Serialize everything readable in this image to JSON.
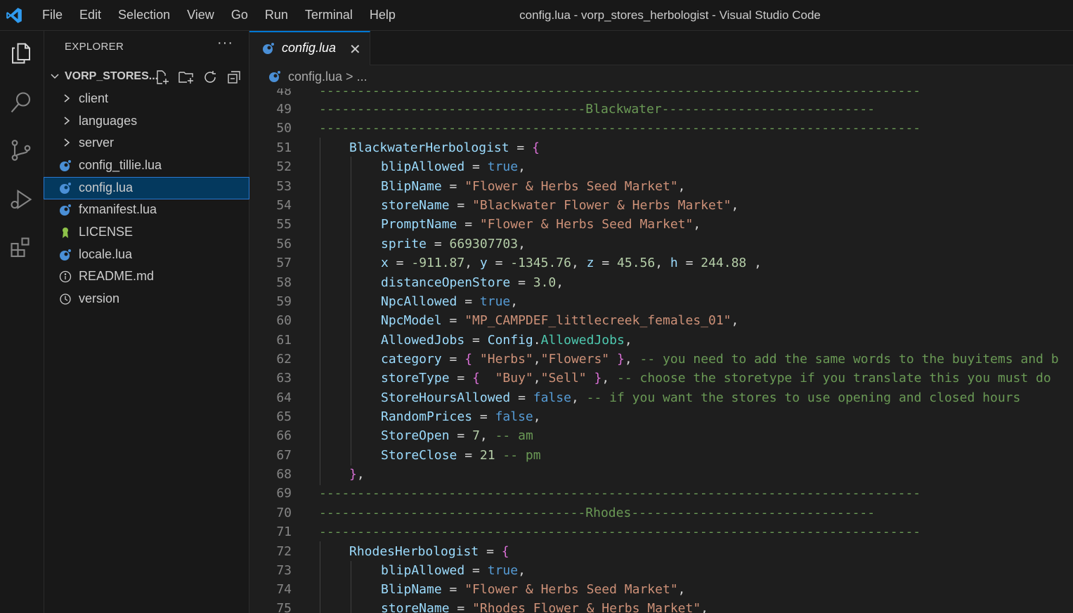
{
  "titlebar": {
    "menu": [
      "File",
      "Edit",
      "Selection",
      "View",
      "Go",
      "Run",
      "Terminal",
      "Help"
    ],
    "window_title": "config.lua - vorp_stores_herbologist - Visual Studio Code"
  },
  "sidebar": {
    "title": "EXPLORER",
    "more": "···",
    "folder_name": "VORP_STORES...",
    "items": [
      {
        "label": "client",
        "type": "folder"
      },
      {
        "label": "languages",
        "type": "folder"
      },
      {
        "label": "server",
        "type": "folder"
      },
      {
        "label": "config_tillie.lua",
        "type": "lua"
      },
      {
        "label": "config.lua",
        "type": "lua",
        "selected": true
      },
      {
        "label": "fxmanifest.lua",
        "type": "lua"
      },
      {
        "label": "LICENSE",
        "type": "license"
      },
      {
        "label": "locale.lua",
        "type": "lua"
      },
      {
        "label": "README.md",
        "type": "info"
      },
      {
        "label": "version",
        "type": "clock"
      }
    ]
  },
  "editor": {
    "tab_label": "config.lua",
    "tab_close": "✕",
    "breadcrumb": "config.lua > ...",
    "lines": [
      {
        "n": "48",
        "t": ""
      },
      {
        "n": "49",
        "t": ""
      },
      {
        "n": "50",
        "t": ""
      },
      {
        "n": "51",
        "t": ""
      },
      {
        "n": "52",
        "t": ""
      },
      {
        "n": "53",
        "t": ""
      },
      {
        "n": "54",
        "t": ""
      },
      {
        "n": "55",
        "t": ""
      },
      {
        "n": "56",
        "t": ""
      },
      {
        "n": "57",
        "t": ""
      },
      {
        "n": "58",
        "t": ""
      },
      {
        "n": "59",
        "t": ""
      },
      {
        "n": "60",
        "t": ""
      },
      {
        "n": "61",
        "t": ""
      },
      {
        "n": "62",
        "t": ""
      },
      {
        "n": "63",
        "t": ""
      },
      {
        "n": "64",
        "t": ""
      },
      {
        "n": "65",
        "t": ""
      },
      {
        "n": "66",
        "t": ""
      },
      {
        "n": "67",
        "t": ""
      },
      {
        "n": "68",
        "t": ""
      },
      {
        "n": "69",
        "t": ""
      },
      {
        "n": "70",
        "t": ""
      },
      {
        "n": "71",
        "t": ""
      },
      {
        "n": "72",
        "t": ""
      },
      {
        "n": "73",
        "t": ""
      },
      {
        "n": "74",
        "t": ""
      },
      {
        "n": "75",
        "t": ""
      }
    ],
    "code": {
      "l48": "-------------------------------------------------------------------------------",
      "l49": "-----------------------------------Blackwater----------------------------",
      "l50": "-------------------------------------------------------------------------------",
      "l51a": "BlackwaterHerbologist",
      "l51b": " = ",
      "l51c": "{",
      "l52a": "blipAllowed",
      "l52b": " = ",
      "l52c": "true",
      "l52d": ",",
      "l53a": "BlipName",
      "l53b": " = ",
      "l53c": "\"Flower & Herbs Seed Market\"",
      "l53d": ",",
      "l54a": "storeName",
      "l54b": " = ",
      "l54c": "\"Blackwater Flower & Herbs Market\"",
      "l54d": ",",
      "l55a": "PromptName",
      "l55b": " = ",
      "l55c": "\"Flower & Herbs Seed Market\"",
      "l55d": ",",
      "l56a": "sprite",
      "l56b": " = ",
      "l56c": "669307703",
      "l56d": ",",
      "l57a": "x",
      "l57b": " = ",
      "l57c": "-911.87",
      "l57d": ", ",
      "l57e": "y",
      "l57f": " = ",
      "l57g": "-1345.76",
      "l57h": ", ",
      "l57i": "z",
      "l57j": " = ",
      "l57k": "45.56",
      "l57l": ", ",
      "l57m": "h",
      "l57n": " = ",
      "l57o": "244.88",
      "l57p": " ,",
      "l58a": "distanceOpenStore",
      "l58b": " = ",
      "l58c": "3.0",
      "l58d": ",",
      "l59a": "NpcAllowed",
      "l59b": " = ",
      "l59c": "true",
      "l59d": ",",
      "l60a": "NpcModel",
      "l60b": " = ",
      "l60c": "\"MP_CAMPDEF_littlecreek_females_01\"",
      "l60d": ",",
      "l61a": "AllowedJobs",
      "l61b": " = ",
      "l61c": "Config",
      "l61d": ".",
      "l61e": "AllowedJobs",
      "l61f": ",",
      "l62a": "category",
      "l62b": " = ",
      "l62c": "{ ",
      "l62d": "\"Herbs\"",
      "l62e": ",",
      "l62f": "\"Flowers\"",
      "l62g": " }",
      "l62h": ", ",
      "l62i": "-- you need to add the same words to the buyitems and b",
      "l63a": "storeType",
      "l63b": " = ",
      "l63c": "{  ",
      "l63d": "\"Buy\"",
      "l63e": ",",
      "l63f": "\"Sell\"",
      "l63g": " }",
      "l63h": ", ",
      "l63i": "-- choose the storetype if you translate this you must do",
      "l64a": "StoreHoursAllowed",
      "l64b": " = ",
      "l64c": "false",
      "l64d": ", ",
      "l64e": "-- if you want the stores to use opening and closed hours",
      "l65a": "RandomPrices",
      "l65b": " = ",
      "l65c": "false",
      "l65d": ",",
      "l66a": "StoreOpen",
      "l66b": " = ",
      "l66c": "7",
      "l66d": ", ",
      "l66e": "-- am",
      "l67a": "StoreClose",
      "l67b": " = ",
      "l67c": "21",
      "l67d": " ",
      "l67e": "-- pm",
      "l68a": "}",
      "l68b": ",",
      "l69": "-------------------------------------------------------------------------------",
      "l70": "-----------------------------------Rhodes--------------------------------",
      "l71": "-------------------------------------------------------------------------------",
      "l72a": "RhodesHerbologist",
      "l72b": " = ",
      "l72c": "{",
      "l73a": "blipAllowed",
      "l73b": " = ",
      "l73c": "true",
      "l73d": ",",
      "l74a": "BlipName",
      "l74b": " = ",
      "l74c": "\"Flower & Herbs Seed Market\"",
      "l74d": ",",
      "l75a": "storeName",
      "l75b": " = ",
      "l75c": "\"Rhodes Flower & Herbs Market\"",
      "l75d": ","
    }
  },
  "colors": {
    "accent": "#0078d4",
    "comment": "#6a9955",
    "string": "#ce9178",
    "keyword": "#569cd6",
    "number": "#b5cea8",
    "variable": "#9cdcfe"
  }
}
